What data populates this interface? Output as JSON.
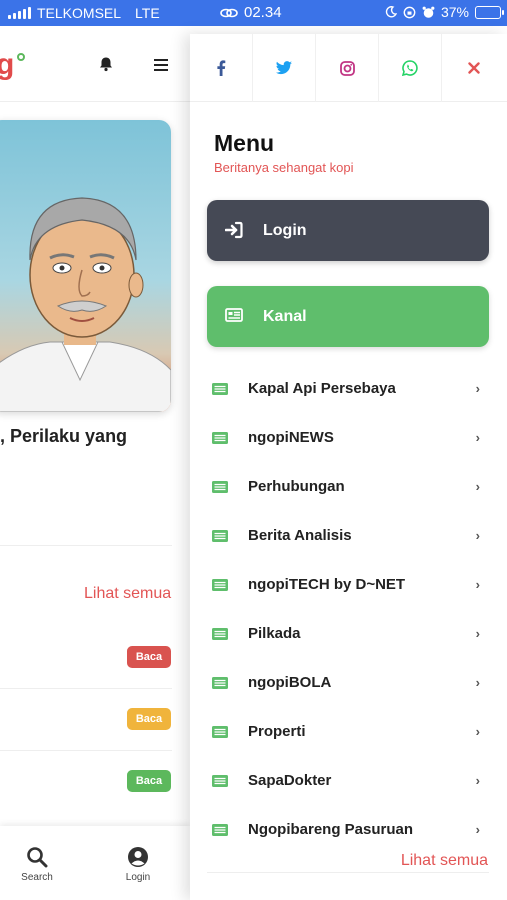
{
  "status_bar": {
    "carrier": "TELKOMSEL",
    "network": "LTE",
    "time": "02.34",
    "battery": "37%",
    "battery_level": 0.37
  },
  "background_page": {
    "logo_text": "g",
    "headline": ", Perilaku yang",
    "see_all": "Lihat semua",
    "read_badges": [
      {
        "label": "Baca",
        "color": "#d9534f"
      },
      {
        "label": "Baca",
        "color": "#f0b43c"
      },
      {
        "label": "Baca",
        "color": "#5cb85c"
      }
    ],
    "bottom_nav": {
      "search_label": "Search",
      "login_label": "Login"
    }
  },
  "drawer": {
    "social": [
      {
        "icon": "facebook-icon",
        "color": "#3b5998"
      },
      {
        "icon": "twitter-icon",
        "color": "#1da1f2"
      },
      {
        "icon": "instagram-icon",
        "color": "#c13584"
      },
      {
        "icon": "whatsapp-icon",
        "color": "#25d366"
      },
      {
        "icon": "close-icon",
        "color": "#e25555"
      }
    ],
    "title": "Menu",
    "tagline": "Beritanya sehangat kopi",
    "login_label": "Login",
    "kanal_label": "Kanal",
    "channels": [
      "Kapal Api Persebaya",
      "ngopiNEWS",
      "Perhubungan",
      "Berita Analisis",
      "ngopiTECH by D~NET",
      "Pilkada",
      "ngopiBOLA",
      "Properti",
      "SapaDokter",
      "Ngopibareng Pasuruan"
    ],
    "see_all": "Lihat semua"
  },
  "colors": {
    "status_bar": "#3b73e8",
    "login_button": "#454955",
    "kanal_button": "#5fbe6c",
    "accent_red": "#e25555",
    "list_icon_green": "#5fbe6c"
  }
}
